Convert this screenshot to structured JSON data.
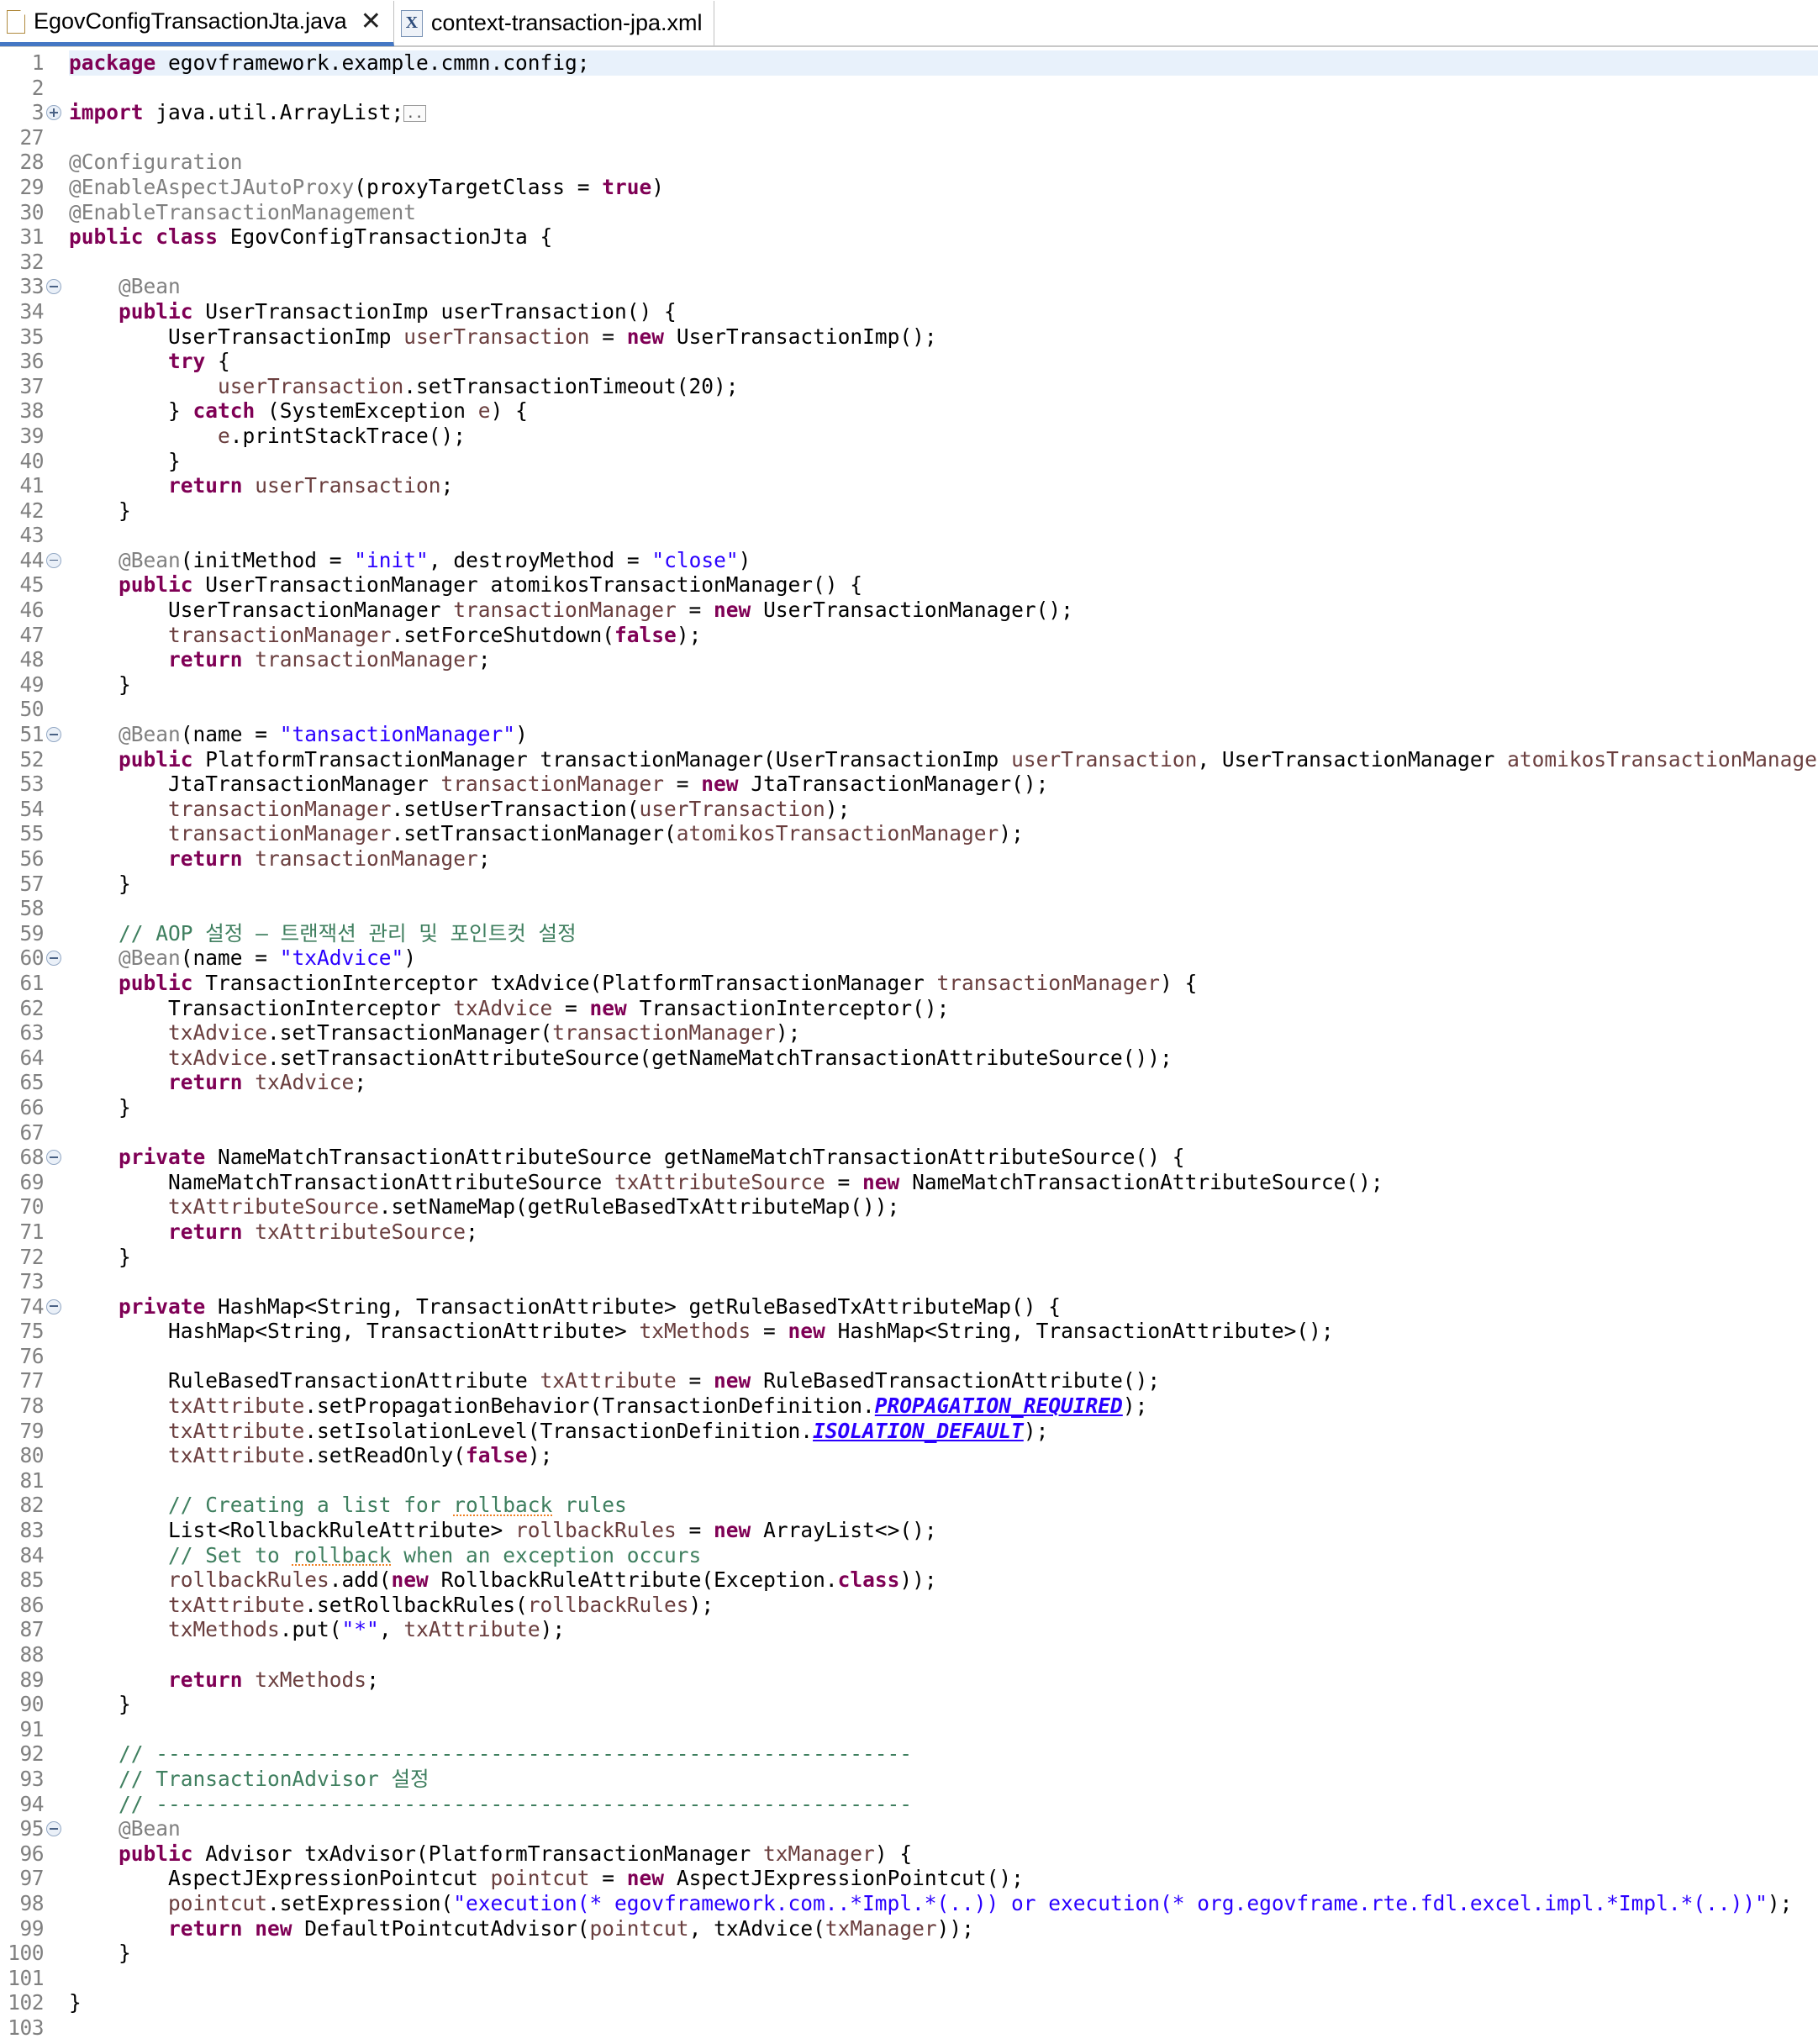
{
  "window": {
    "app": "Eclipse IDE Java Editor"
  },
  "tabs": [
    {
      "label": "EgovConfigTransactionJta.java",
      "icon": "java-file-icon",
      "active": true,
      "close_glyph": "✕"
    },
    {
      "label": "context-transaction-jpa.xml",
      "icon": "xml-file-icon",
      "active": false,
      "icon_glyph": "X"
    }
  ],
  "editor": {
    "highlighted_line": 1,
    "fold_markers": {
      "3": "plus",
      "33": "minus",
      "44": "minus",
      "51": "minus",
      "60": "minus",
      "68": "minus",
      "74": "minus",
      "95": "minus"
    },
    "colors": {
      "keyword": "#7f0055",
      "annotation": "#808080",
      "string": "#2a00ff",
      "comment": "#3f7f5f",
      "local_var": "#6a3e3e",
      "static_constant": "#2a00ff",
      "line_number": "#808080",
      "current_line_highlight": "#e8f1fb",
      "spellcheck_underline": "#f08020",
      "background": "#ffffff"
    },
    "line_numbers": [
      1,
      2,
      3,
      27,
      28,
      29,
      30,
      31,
      32,
      33,
      34,
      35,
      36,
      37,
      38,
      39,
      40,
      41,
      42,
      43,
      44,
      45,
      46,
      47,
      48,
      49,
      50,
      51,
      52,
      53,
      54,
      55,
      56,
      57,
      58,
      59,
      60,
      61,
      62,
      63,
      64,
      65,
      66,
      67,
      68,
      69,
      70,
      71,
      72,
      73,
      74,
      75,
      76,
      77,
      78,
      79,
      80,
      81,
      82,
      83,
      84,
      85,
      86,
      87,
      88,
      89,
      90,
      91,
      92,
      93,
      94,
      95,
      96,
      97,
      98,
      99,
      100,
      101,
      102,
      103
    ],
    "lines": [
      {
        "n": 1,
        "html": "<span class=\"kw\">package</span> egovframework.example.cmmn.config;"
      },
      {
        "n": 2,
        "html": ""
      },
      {
        "n": 3,
        "html": "<span class=\"kw\">import</span> java.util.ArrayList;<span class=\"foldbox\">..</span>"
      },
      {
        "n": 27,
        "html": ""
      },
      {
        "n": 28,
        "html": "<span class=\"ann\">@Configuration</span>"
      },
      {
        "n": 29,
        "html": "<span class=\"ann\">@EnableAspectJAutoProxy</span>(proxyTargetClass = <span class=\"kw\">true</span>)"
      },
      {
        "n": 30,
        "html": "<span class=\"ann\">@EnableTransactionManagement</span>"
      },
      {
        "n": 31,
        "html": "<span class=\"kw\">public class</span> EgovConfigTransactionJta {"
      },
      {
        "n": 32,
        "html": ""
      },
      {
        "n": 33,
        "html": "    <span class=\"ann\">@Bean</span>"
      },
      {
        "n": 34,
        "html": "    <span class=\"kw\">public</span> UserTransactionImp userTransaction() {"
      },
      {
        "n": 35,
        "html": "        UserTransactionImp <span class=\"loc\">userTransaction</span> = <span class=\"kw\">new</span> UserTransactionImp();"
      },
      {
        "n": 36,
        "html": "        <span class=\"kw\">try</span> {"
      },
      {
        "n": 37,
        "html": "            <span class=\"loc\">userTransaction</span>.setTransactionTimeout(20);"
      },
      {
        "n": 38,
        "html": "        } <span class=\"kw\">catch</span> (SystemException <span class=\"loc\">e</span>) {"
      },
      {
        "n": 39,
        "html": "            <span class=\"loc\">e</span>.printStackTrace();"
      },
      {
        "n": 40,
        "html": "        }"
      },
      {
        "n": 41,
        "html": "        <span class=\"kw\">return</span> <span class=\"loc\">userTransaction</span>;"
      },
      {
        "n": 42,
        "html": "    }"
      },
      {
        "n": 43,
        "html": ""
      },
      {
        "n": 44,
        "html": "    <span class=\"ann\">@Bean</span>(initMethod = <span class=\"str\">\"init\"</span>, destroyMethod = <span class=\"str\">\"close\"</span>)"
      },
      {
        "n": 45,
        "html": "    <span class=\"kw\">public</span> UserTransactionManager atomikosTransactionManager() {"
      },
      {
        "n": 46,
        "html": "        UserTransactionManager <span class=\"loc\">transactionManager</span> = <span class=\"kw\">new</span> UserTransactionManager();"
      },
      {
        "n": 47,
        "html": "        <span class=\"loc\">transactionManager</span>.setForceShutdown(<span class=\"kw\">false</span>);"
      },
      {
        "n": 48,
        "html": "        <span class=\"kw\">return</span> <span class=\"loc\">transactionManager</span>;"
      },
      {
        "n": 49,
        "html": "    }"
      },
      {
        "n": 50,
        "html": ""
      },
      {
        "n": 51,
        "html": "    <span class=\"ann\">@Bean</span>(name = <span class=\"str\">\"tansactionManager\"</span>)"
      },
      {
        "n": 52,
        "html": "    <span class=\"kw\">public</span> PlatformTransactionManager transactionManager(UserTransactionImp <span class=\"loc\">userTransaction</span>, UserTransactionManager <span class=\"loc\">atomikosTransactionManager</span>) {"
      },
      {
        "n": 53,
        "html": "        JtaTransactionManager <span class=\"loc\">transactionManager</span> = <span class=\"kw\">new</span> JtaTransactionManager();"
      },
      {
        "n": 54,
        "html": "        <span class=\"loc\">transactionManager</span>.setUserTransaction(<span class=\"loc\">userTransaction</span>);"
      },
      {
        "n": 55,
        "html": "        <span class=\"loc\">transactionManager</span>.setTransactionManager(<span class=\"loc\">atomikosTransactionManager</span>);"
      },
      {
        "n": 56,
        "html": "        <span class=\"kw\">return</span> <span class=\"loc\">transactionManager</span>;"
      },
      {
        "n": 57,
        "html": "    }"
      },
      {
        "n": 58,
        "html": ""
      },
      {
        "n": 59,
        "html": "    <span class=\"cmt\">// AOP 설정 – 트랜잭션 관리 및 포인트컷 설정</span>"
      },
      {
        "n": 60,
        "html": "    <span class=\"ann\">@Bean</span>(name = <span class=\"str\">\"txAdvice\"</span>)"
      },
      {
        "n": 61,
        "html": "    <span class=\"kw\">public</span> TransactionInterceptor txAdvice(PlatformTransactionManager <span class=\"loc\">transactionManager</span>) {"
      },
      {
        "n": 62,
        "html": "        TransactionInterceptor <span class=\"loc\">txAdvice</span> = <span class=\"kw\">new</span> TransactionInterceptor();"
      },
      {
        "n": 63,
        "html": "        <span class=\"loc\">txAdvice</span>.setTransactionManager(<span class=\"loc\">transactionManager</span>);"
      },
      {
        "n": 64,
        "html": "        <span class=\"loc\">txAdvice</span>.setTransactionAttributeSource(getNameMatchTransactionAttributeSource());"
      },
      {
        "n": 65,
        "html": "        <span class=\"kw\">return</span> <span class=\"loc\">txAdvice</span>;"
      },
      {
        "n": 66,
        "html": "    }"
      },
      {
        "n": 67,
        "html": ""
      },
      {
        "n": 68,
        "html": "    <span class=\"kw\">private</span> NameMatchTransactionAttributeSource getNameMatchTransactionAttributeSource() {"
      },
      {
        "n": 69,
        "html": "        NameMatchTransactionAttributeSource <span class=\"loc\">txAttributeSource</span> = <span class=\"kw\">new</span> NameMatchTransactionAttributeSource();"
      },
      {
        "n": 70,
        "html": "        <span class=\"loc\">txAttributeSource</span>.setNameMap(getRuleBasedTxAttributeMap());"
      },
      {
        "n": 71,
        "html": "        <span class=\"kw\">return</span> <span class=\"loc\">txAttributeSource</span>;"
      },
      {
        "n": 72,
        "html": "    }"
      },
      {
        "n": 73,
        "html": ""
      },
      {
        "n": 74,
        "html": "    <span class=\"kw\">private</span> HashMap&lt;String, TransactionAttribute&gt; getRuleBasedTxAttributeMap() {"
      },
      {
        "n": 75,
        "html": "        HashMap&lt;String, TransactionAttribute&gt; <span class=\"loc\">txMethods</span> = <span class=\"kw\">new</span> HashMap&lt;String, TransactionAttribute&gt;();"
      },
      {
        "n": 76,
        "html": ""
      },
      {
        "n": 77,
        "html": "        RuleBasedTransactionAttribute <span class=\"loc\">txAttribute</span> = <span class=\"kw\">new</span> RuleBasedTransactionAttribute();"
      },
      {
        "n": 78,
        "html": "        <span class=\"loc\">txAttribute</span>.setPropagationBehavior(TransactionDefinition.<span class=\"cst\">PROPAGATION_REQUIRED</span>);"
      },
      {
        "n": 79,
        "html": "        <span class=\"loc\">txAttribute</span>.setIsolationLevel(TransactionDefinition.<span class=\"cst\">ISOLATION_DEFAULT</span>);"
      },
      {
        "n": 80,
        "html": "        <span class=\"loc\">txAttribute</span>.setReadOnly(<span class=\"kw\">false</span>);"
      },
      {
        "n": 81,
        "html": ""
      },
      {
        "n": 82,
        "html": "        <span class=\"cmt\">// Creating a list for <span class=\"spell\">rollback</span> rules</span>"
      },
      {
        "n": 83,
        "html": "        List&lt;RollbackRuleAttribute&gt; <span class=\"loc\">rollbackRules</span> = <span class=\"kw\">new</span> ArrayList&lt;&gt;();"
      },
      {
        "n": 84,
        "html": "        <span class=\"cmt\">// Set to <span class=\"spell\">rollback</span> when an exception occurs</span>"
      },
      {
        "n": 85,
        "html": "        <span class=\"loc\">rollbackRules</span>.add(<span class=\"kw\">new</span> RollbackRuleAttribute(Exception.<span class=\"kw\">class</span>));"
      },
      {
        "n": 86,
        "html": "        <span class=\"loc\">txAttribute</span>.setRollbackRules(<span class=\"loc\">rollbackRules</span>);"
      },
      {
        "n": 87,
        "html": "        <span class=\"loc\">txMethods</span>.put(<span class=\"str\">\"*\"</span>, <span class=\"loc\">txAttribute</span>);"
      },
      {
        "n": 88,
        "html": ""
      },
      {
        "n": 89,
        "html": "        <span class=\"kw\">return</span> <span class=\"loc\">txMethods</span>;"
      },
      {
        "n": 90,
        "html": "    }"
      },
      {
        "n": 91,
        "html": ""
      },
      {
        "n": 92,
        "html": "    <span class=\"cmt\">// -------------------------------------------------------------</span>"
      },
      {
        "n": 93,
        "html": "    <span class=\"cmt\">// TransactionAdvisor 설정</span>"
      },
      {
        "n": 94,
        "html": "    <span class=\"cmt\">// -------------------------------------------------------------</span>"
      },
      {
        "n": 95,
        "html": "    <span class=\"ann\">@Bean</span>"
      },
      {
        "n": 96,
        "html": "    <span class=\"kw\">public</span> Advisor txAdvisor(PlatformTransactionManager <span class=\"loc\">txManager</span>) {"
      },
      {
        "n": 97,
        "html": "        AspectJExpressionPointcut <span class=\"loc\">pointcut</span> = <span class=\"kw\">new</span> AspectJExpressionPointcut();"
      },
      {
        "n": 98,
        "html": "        <span class=\"loc\">pointcut</span>.setExpression(<span class=\"str\">\"execution(* egovframework.com..*Impl.*(..)) or execution(* org.egovframe.rte.fdl.excel.impl.*Impl.*(..))\"</span>);"
      },
      {
        "n": 99,
        "html": "        <span class=\"kw\">return new</span> DefaultPointcutAdvisor(<span class=\"loc\">pointcut</span>, txAdvice(<span class=\"loc\">txManager</span>));"
      },
      {
        "n": 100,
        "html": "    }"
      },
      {
        "n": 101,
        "html": ""
      },
      {
        "n": 102,
        "html": "}"
      },
      {
        "n": 103,
        "html": ""
      }
    ],
    "plain_text_lines": [
      "package egovframework.example.cmmn.config;",
      "",
      "import java.util.ArrayList;",
      "",
      "@Configuration",
      "@EnableAspectJAutoProxy(proxyTargetClass = true)",
      "@EnableTransactionManagement",
      "public class EgovConfigTransactionJta {",
      "",
      "    @Bean",
      "    public UserTransactionImp userTransaction() {",
      "        UserTransactionImp userTransaction = new UserTransactionImp();",
      "        try {",
      "            userTransaction.setTransactionTimeout(20);",
      "        } catch (SystemException e) {",
      "            e.printStackTrace();",
      "        }",
      "        return userTransaction;",
      "    }",
      "",
      "    @Bean(initMethod = \"init\", destroyMethod = \"close\")",
      "    public UserTransactionManager atomikosTransactionManager() {",
      "        UserTransactionManager transactionManager = new UserTransactionManager();",
      "        transactionManager.setForceShutdown(false);",
      "        return transactionManager;",
      "    }",
      "",
      "    @Bean(name = \"tansactionManager\")",
      "    public PlatformTransactionManager transactionManager(UserTransactionImp userTransaction, UserTransactionManager atomikosTransactionManager) {",
      "        JtaTransactionManager transactionManager = new JtaTransactionManager();",
      "        transactionManager.setUserTransaction(userTransaction);",
      "        transactionManager.setTransactionManager(atomikosTransactionManager);",
      "        return transactionManager;",
      "    }",
      "",
      "    // AOP 설정 – 트랜잭션 관리 및 포인트컷 설정",
      "    @Bean(name = \"txAdvice\")",
      "    public TransactionInterceptor txAdvice(PlatformTransactionManager transactionManager) {",
      "        TransactionInterceptor txAdvice = new TransactionInterceptor();",
      "        txAdvice.setTransactionManager(transactionManager);",
      "        txAdvice.setTransactionAttributeSource(getNameMatchTransactionAttributeSource());",
      "        return txAdvice;",
      "    }",
      "",
      "    private NameMatchTransactionAttributeSource getNameMatchTransactionAttributeSource() {",
      "        NameMatchTransactionAttributeSource txAttributeSource = new NameMatchTransactionAttributeSource();",
      "        txAttributeSource.setNameMap(getRuleBasedTxAttributeMap());",
      "        return txAttributeSource;",
      "    }",
      "",
      "    private HashMap<String, TransactionAttribute> getRuleBasedTxAttributeMap() {",
      "        HashMap<String, TransactionAttribute> txMethods = new HashMap<String, TransactionAttribute>();",
      "",
      "        RuleBasedTransactionAttribute txAttribute = new RuleBasedTransactionAttribute();",
      "        txAttribute.setPropagationBehavior(TransactionDefinition.PROPAGATION_REQUIRED);",
      "        txAttribute.setIsolationLevel(TransactionDefinition.ISOLATION_DEFAULT);",
      "        txAttribute.setReadOnly(false);",
      "",
      "        // Creating a list for rollback rules",
      "        List<RollbackRuleAttribute> rollbackRules = new ArrayList<>();",
      "        // Set to rollback when an exception occurs",
      "        rollbackRules.add(new RollbackRuleAttribute(Exception.class));",
      "        txAttribute.setRollbackRules(rollbackRules);",
      "        txMethods.put(\"*\", txAttribute);",
      "",
      "        return txMethods;",
      "    }",
      "",
      "    // -------------------------------------------------------------",
      "    // TransactionAdvisor 설정",
      "    // -------------------------------------------------------------",
      "    @Bean",
      "    public Advisor txAdvisor(PlatformTransactionManager txManager) {",
      "        AspectJExpressionPointcut pointcut = new AspectJExpressionPointcut();",
      "        pointcut.setExpression(\"execution(* egovframework.com..*Impl.*(..)) or execution(* org.egovframe.rte.fdl.excel.impl.*Impl.*(..))\");",
      "        return new DefaultPointcutAdvisor(pointcut, txAdvice(txManager));",
      "    }",
      "",
      "}"
    ]
  }
}
